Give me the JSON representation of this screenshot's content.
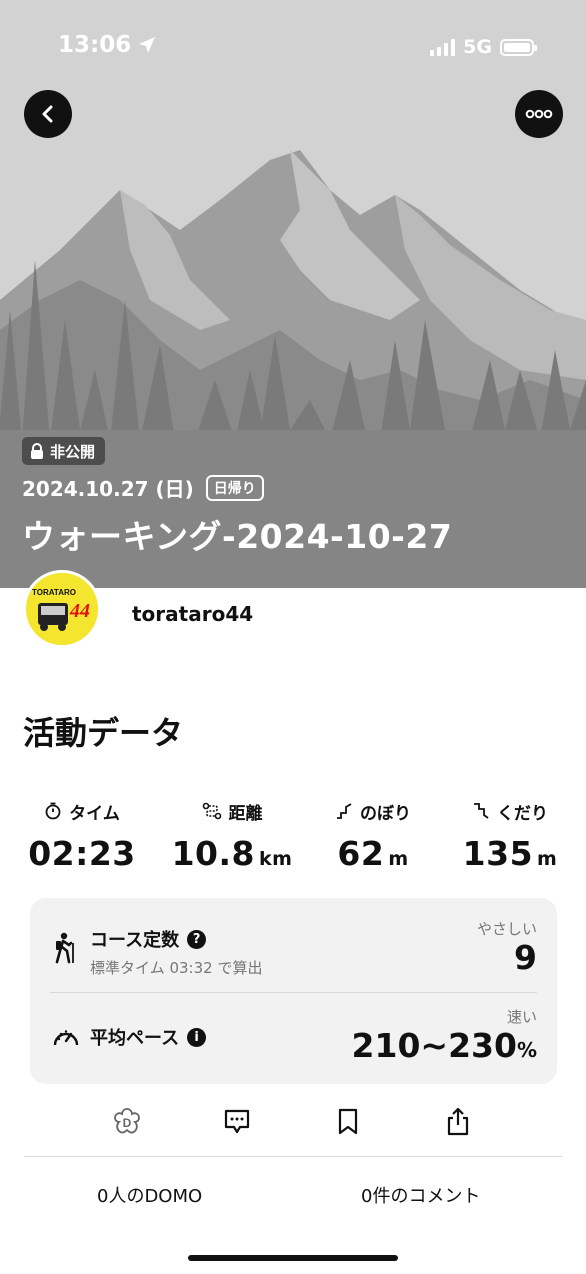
{
  "status_bar": {
    "time": "13:06",
    "network": "5G"
  },
  "activity": {
    "visibility": "非公開",
    "date": "2024.10.27 (日)",
    "trip_type": "日帰り",
    "title": "ウォーキング-2024-10-27"
  },
  "user": {
    "name": "torataro44",
    "avatar_text": "TORATARO",
    "avatar_number": "44"
  },
  "section": {
    "title": "活動データ"
  },
  "stats": [
    {
      "label": "タイム",
      "value": "02:23",
      "unit": "",
      "icon": "stopwatch-icon"
    },
    {
      "label": "距離",
      "value": "10.8",
      "unit": "km",
      "icon": "route-icon"
    },
    {
      "label": "のぼり",
      "value": "62",
      "unit": "m",
      "icon": "ascent-icon"
    },
    {
      "label": "くだり",
      "value": "135",
      "unit": "m",
      "icon": "descent-icon"
    }
  ],
  "course_constant": {
    "label": "コース定数",
    "sub": "標準タイム 03:32 で算出",
    "rating": "やさしい",
    "value": "9"
  },
  "pace": {
    "label": "平均ペース",
    "rating": "速い",
    "value": "210~230",
    "unit": "%"
  },
  "counts": {
    "domo": "0人のDOMO",
    "comments": "0件のコメント"
  },
  "colors": {
    "hero_bg": "#d2d2d2",
    "avatar_bg": "#f4e62f",
    "card_bg": "#f2f2f2",
    "badge_bg": "#4d4d4d"
  }
}
